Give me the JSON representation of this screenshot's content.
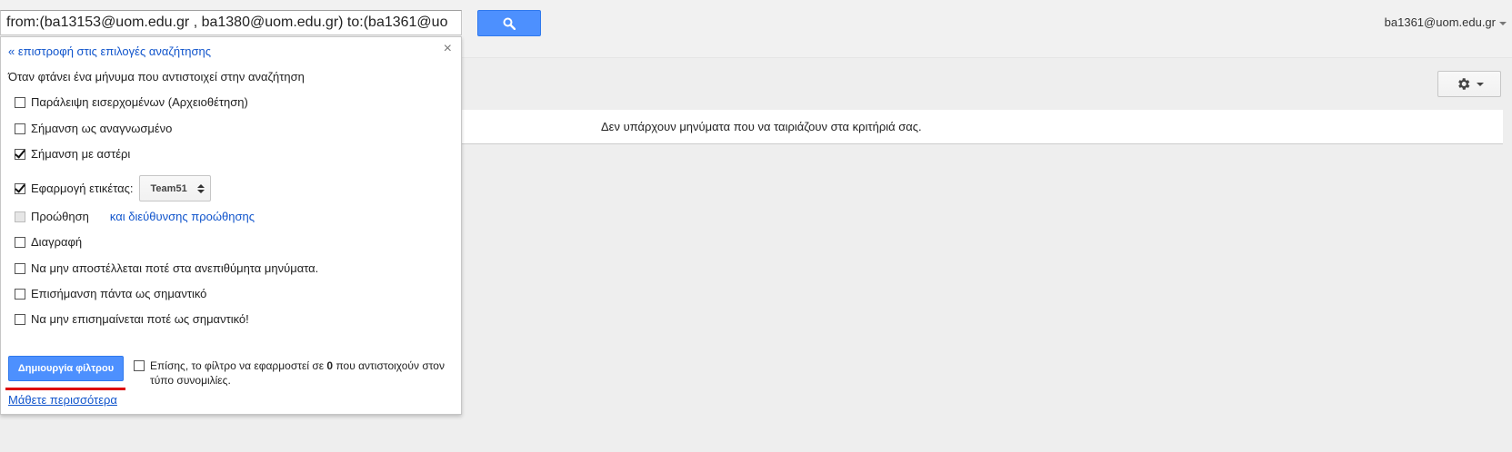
{
  "search": {
    "query": "from:(ba13153@uom.edu.gr , ba1380@uom.edu.gr) to:(ba1361@uo",
    "button_icon": "search-icon"
  },
  "account": {
    "email": "ba1361@uom.edu.gr"
  },
  "settings": {
    "icon": "gear-icon"
  },
  "results": {
    "empty_message": "Δεν υπάρχουν μηνύματα που να ταιριάζουν στα κριτήριά σας."
  },
  "filter_panel": {
    "back_link": "« επιστροφή στις επιλογές αναζήτησης",
    "close": "×",
    "intro": "Όταν φτάνει ένα μήνυμα που αντιστοιχεί στην αναζήτηση",
    "options": {
      "skip_inbox": {
        "label": "Παράλειψη εισερχομένων (Αρχειοθέτηση)",
        "checked": false
      },
      "mark_read": {
        "label": "Σήμανση ως αναγνωσμένο",
        "checked": false
      },
      "star": {
        "label": "Σήμανση με αστέρι",
        "checked": true
      },
      "apply_label": {
        "label": "Εφαρμογή ετικέτας:",
        "checked": true,
        "selected_label": "Team51"
      },
      "forward": {
        "label": "Προώθηση",
        "checked": false,
        "disabled": true,
        "link": "και διεύθυνσης προώθησης"
      },
      "delete": {
        "label": "Διαγραφή",
        "checked": false
      },
      "never_spam": {
        "label": "Να μην αποστέλλεται ποτέ στα ανεπιθύμητα μηνύματα.",
        "checked": false
      },
      "always_important": {
        "label": "Επισήμανση πάντα ως σημαντικό",
        "checked": false
      },
      "never_important": {
        "label": "Να μην επισημαίνεται ποτέ ως σημαντικό!",
        "checked": false
      }
    },
    "create_button": "Δημιουργία φίλτρου",
    "also_apply": {
      "prefix": "Επίσης, το φίλτρο να εφαρμοστεί σε ",
      "count": "0",
      "suffix": " που αντιστοιχούν στον τύπο συνομιλίες.",
      "checked": false
    },
    "learn_more": "Μάθετε περισσότερα"
  }
}
